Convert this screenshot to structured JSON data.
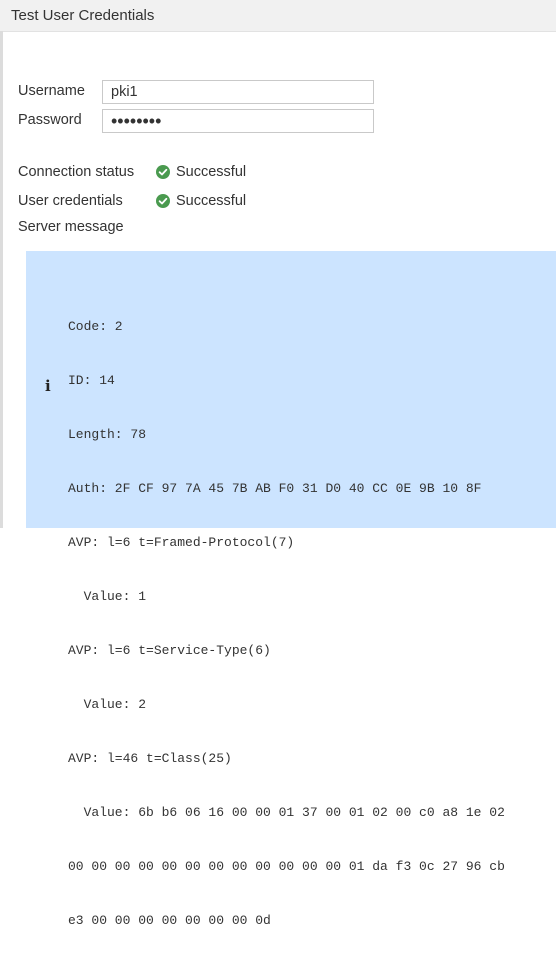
{
  "dialog": {
    "title": "Test User Credentials"
  },
  "form": {
    "username_label": "Username",
    "username_value": "pki1",
    "password_label": "Password",
    "password_value": "••••••••"
  },
  "results": {
    "connection_label": "Connection status",
    "connection_value": "Successful",
    "credentials_label": "User credentials",
    "credentials_value": "Successful",
    "server_message_label": "Server message"
  },
  "server_message": {
    "lines": [
      "Code: 2",
      "ID: 14",
      "Length: 78",
      "Auth: 2F CF 97 7A 45 7B AB F0 31 D0 40 CC 0E 9B 10 8F",
      "AVP: l=6 t=Framed-Protocol(7)",
      "  Value: 1",
      "AVP: l=6 t=Service-Type(6)",
      "  Value: 2",
      "AVP: l=46 t=Class(25)",
      "  Value: 6b b6 06 16 00 00 01 37 00 01 02 00 c0 a8 1e 02",
      "00 00 00 00 00 00 00 00 00 00 00 00 01 da f3 0c 27 96 cb",
      "e3 00 00 00 00 00 00 00 0d"
    ]
  },
  "colors": {
    "success": "#4a9a4f",
    "message_bg": "#cce4ff"
  }
}
